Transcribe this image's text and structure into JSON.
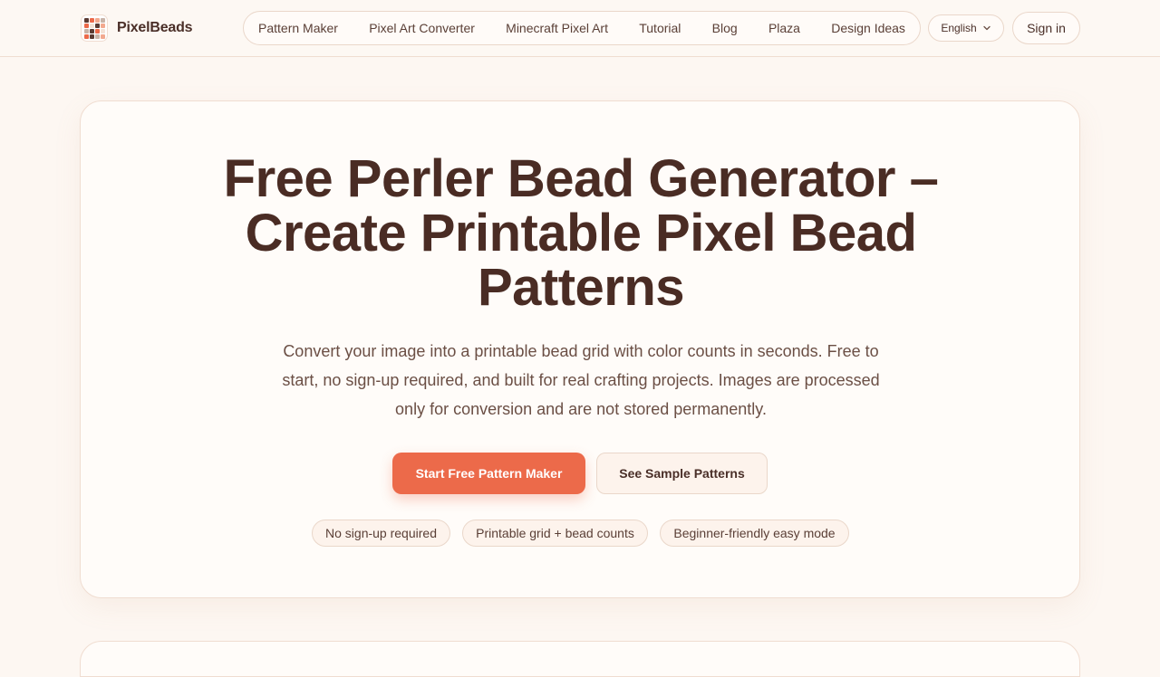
{
  "brand": {
    "name": "PixelBeads",
    "logo_colors": [
      "#5a3b33",
      "#ec6a4a",
      "#f2a98f",
      "#c8b4a8",
      "#ec6a4a",
      "#f3e2d6",
      "#5a3b33",
      "#f2a98f",
      "#c8b4a8",
      "#5a3b33",
      "#ec6a4a",
      "#f3e2d6",
      "#ec6a4a",
      "#5a3b33",
      "#c8b4a8",
      "#f2a98f"
    ]
  },
  "nav": {
    "items": [
      "Pattern Maker",
      "Pixel Art Converter",
      "Minecraft Pixel Art",
      "Tutorial",
      "Blog",
      "Plaza",
      "Design Ideas"
    ]
  },
  "header": {
    "language": "English",
    "language_icon": "chevron-down-icon",
    "sign_in": "Sign in"
  },
  "hero": {
    "title": "Free Perler Bead Generator – Create Printable Pixel Bead Patterns",
    "description": "Convert your image into a printable bead grid with color counts in seconds. Free to start, no sign-up required, and built for real crafting projects. Images are processed only for conversion and are not stored permanently.",
    "cta_primary": "Start Free Pattern Maker",
    "cta_secondary": "See Sample Patterns",
    "chips": [
      "No sign-up required",
      "Printable grid + bead counts",
      "Beginner-friendly easy mode"
    ]
  },
  "colors": {
    "accent": "#ec6a4a",
    "text": "#4a2c24",
    "background": "#fdf7f2"
  }
}
